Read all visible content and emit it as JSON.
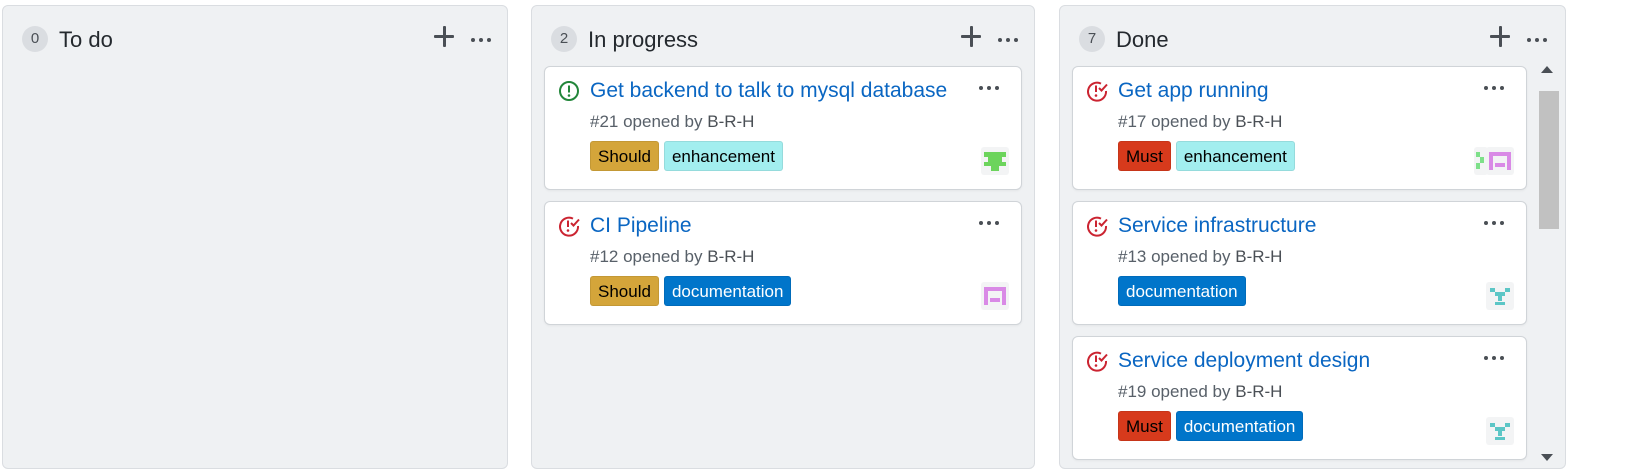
{
  "colors": {
    "link": "#0a66c2",
    "open_issue": "#22863a",
    "closed_issue": "#cb2431",
    "column_bg": "#eff1f3",
    "label_should": "#d4a53a",
    "label_must": "#d73a1c",
    "label_enhancement": "#a2eeef",
    "label_documentation": "#0075ca"
  },
  "columns": [
    {
      "count": "0",
      "title": "To do",
      "add_icon": "plus-icon",
      "menu_icon": "kebab-horizontal-icon",
      "cards": []
    },
    {
      "count": "2",
      "title": "In progress",
      "add_icon": "plus-icon",
      "menu_icon": "kebab-horizontal-icon",
      "cards": [
        {
          "status": "open",
          "status_icon": "issue-opened-icon",
          "title": "Get backend to talk to mysql database",
          "number_text": "#21 opened by",
          "author": "B-R-H",
          "labels": [
            {
              "name": "Should",
              "bg": "#d4a53a",
              "fg": "#000000"
            },
            {
              "name": "enhancement",
              "bg": "#a2eeef",
              "fg": "#000000"
            }
          ],
          "avatar": "identicon-green"
        },
        {
          "status": "closed",
          "status_icon": "issue-closed-icon",
          "title": "CI Pipeline",
          "number_text": "#12 opened by",
          "author": "B-R-H",
          "labels": [
            {
              "name": "Should",
              "bg": "#d4a53a",
              "fg": "#000000"
            },
            {
              "name": "documentation",
              "bg": "#0075ca",
              "fg": "#ffffff"
            }
          ],
          "avatar": "identicon-purple"
        }
      ]
    },
    {
      "count": "7",
      "title": "Done",
      "add_icon": "plus-icon",
      "menu_icon": "kebab-horizontal-icon",
      "cards": [
        {
          "status": "closed",
          "status_icon": "issue-closed-icon",
          "title": "Get app running",
          "number_text": "#17 opened by",
          "author": "B-R-H",
          "labels": [
            {
              "name": "Must",
              "bg": "#d73a1c",
              "fg": "#000000"
            },
            {
              "name": "enhancement",
              "bg": "#a2eeef",
              "fg": "#000000"
            }
          ],
          "avatar": "identicon-green-purple"
        },
        {
          "status": "closed",
          "status_icon": "issue-closed-icon",
          "title": "Service infrastructure",
          "number_text": "#13 opened by",
          "author": "B-R-H",
          "labels": [
            {
              "name": "documentation",
              "bg": "#0075ca",
              "fg": "#ffffff"
            }
          ],
          "avatar": "identicon-teal"
        },
        {
          "status": "closed",
          "status_icon": "issue-closed-icon",
          "title": "Service deployment design",
          "number_text": "#19 opened by",
          "author": "B-R-H",
          "labels": [
            {
              "name": "Must",
              "bg": "#d73a1c",
              "fg": "#000000"
            },
            {
              "name": "documentation",
              "bg": "#0075ca",
              "fg": "#ffffff"
            }
          ],
          "avatar": "identicon-teal"
        }
      ]
    }
  ]
}
